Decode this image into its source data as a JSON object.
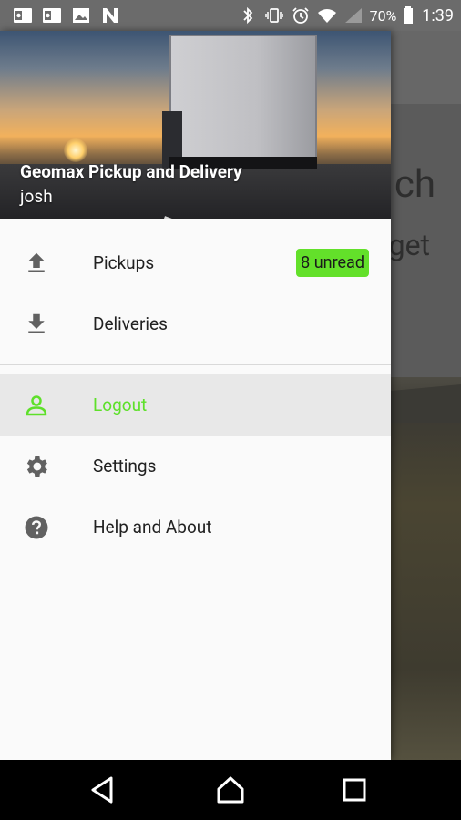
{
  "status_bar": {
    "battery": "70%",
    "time": "1:39",
    "left_icons": [
      "outlook-icon",
      "outlook-icon",
      "image-icon",
      "n-app-icon"
    ],
    "right_icons": [
      "bluetooth-icon",
      "vibrate-icon",
      "alarm-icon",
      "wifi-icon",
      "signal-icon",
      "battery-icon"
    ]
  },
  "background": {
    "text1": "ch",
    "text2": "get"
  },
  "drawer": {
    "header": {
      "title": "Geomax Pickup and Delivery",
      "user": "josh"
    },
    "items": [
      {
        "label": "Pickups",
        "icon": "upload-icon",
        "badge": "8 unread"
      },
      {
        "label": "Deliveries",
        "icon": "download-icon"
      }
    ],
    "items2": [
      {
        "label": "Logout",
        "icon": "person-icon",
        "active": true
      },
      {
        "label": "Settings",
        "icon": "gear-icon"
      },
      {
        "label": "Help and About",
        "icon": "help-icon"
      }
    ]
  },
  "colors": {
    "accent": "#5ee02a",
    "badge": "#63e02a",
    "active_bg": "#e8e8e8"
  },
  "nav": [
    "back-icon",
    "home-icon",
    "recents-icon"
  ]
}
